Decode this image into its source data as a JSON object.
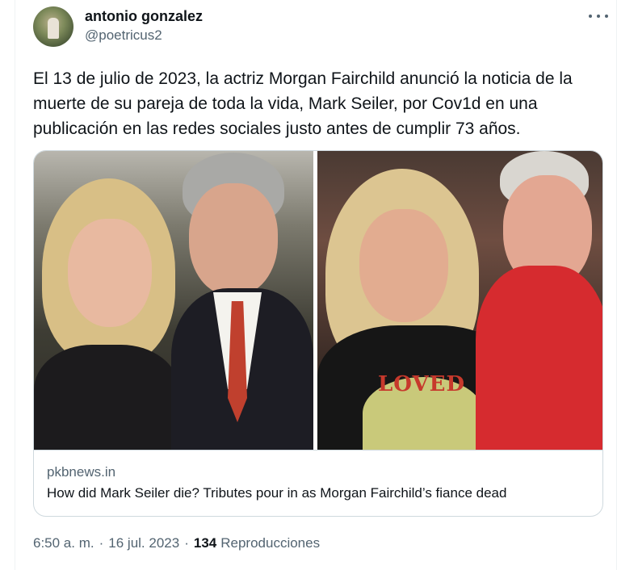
{
  "author": {
    "display_name": "antonio gonzalez",
    "handle": "@poetricus2"
  },
  "tweet": {
    "text": "El 13 de julio de 2023, la actriz Morgan Fairchild anunció la noticia de la muerte de su pareja de toda la vida, Mark Seiler, por Cov1d en una publicación en las redes sociales justo antes de cumplir 73 años."
  },
  "card": {
    "domain": "pkbnews.in",
    "title": "How did Mark Seiler die? Tributes pour in as Morgan Fairchild’s fiance dead",
    "shirt_text": "LOVED"
  },
  "meta": {
    "time": "6:50 a. m.",
    "date": "16 jul. 2023",
    "separator": "·",
    "views_count": "134",
    "views_label": "Reproducciones"
  },
  "colors": {
    "text": "#0f1419",
    "secondary": "#536471",
    "border": "#cfd9de"
  },
  "icons": {
    "more": "more-dots-icon"
  }
}
